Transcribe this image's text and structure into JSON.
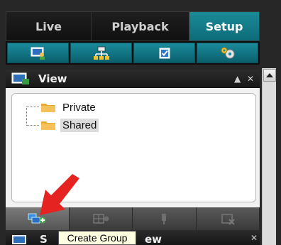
{
  "tabs": [
    {
      "label": "Live"
    },
    {
      "label": "Playback"
    },
    {
      "label": "Setup"
    }
  ],
  "toolbar_icons": [
    "monitor-user-icon",
    "network-icon",
    "checkbox-icon",
    "settings-gears-icon"
  ],
  "panel": {
    "title": "View",
    "minimize_glyph": "▲",
    "close_glyph": "✕"
  },
  "tree": {
    "items": [
      {
        "label": "Private",
        "selected": false
      },
      {
        "label": "Shared",
        "selected": true
      }
    ]
  },
  "bottom_toolbar": {
    "buttons": [
      "create-group-icon",
      "layout-add-icon",
      "pin-icon",
      "delete-icon"
    ]
  },
  "panel2": {
    "title_fragment_left": "S",
    "title_fragment_right": "ew",
    "close_glyph": "✕"
  },
  "tooltip": {
    "text": "Create Group"
  },
  "colors": {
    "accent": "#0f7a88",
    "arrow": "#e52421"
  }
}
